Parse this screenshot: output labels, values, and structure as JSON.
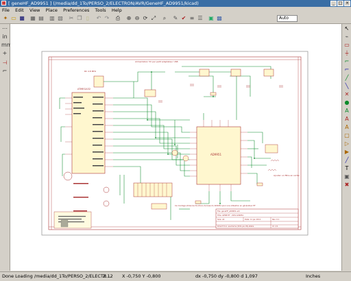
{
  "window": {
    "title": "[ geneHF_AD9951 ] (/media/dd_1To/PERSO_2/ELECTRON/AVR/GeneHF_AD9951/kicad)"
  },
  "menu": {
    "items": [
      "File",
      "Edit",
      "View",
      "Place",
      "Preferences",
      "Tools",
      "Help"
    ]
  },
  "toolbar": {
    "zoom": "Auto"
  },
  "schematic": {
    "title_top": "Alimentation 5V par petit adaptateur USB",
    "block_left_label": "RC 4.8 MHz",
    "note_right": "Ajouter un filtre en sortie",
    "note_bottom": "Ce montage utilise les fonctions de base du AD9951 pour une utilisation en générateur HF",
    "sheet_file": "File: geneHF_AD9951.sch",
    "sheet_title": "Title: GENE HF - DDS AD9951",
    "sheet_size": "Size: A4",
    "sheet_date": "Date: 11 jan 2011",
    "sheet_rev": "Rev: 0.1",
    "sheet_kicad": "KiCad E.D.A.  eeschema (2011-jan-09)-stable",
    "sheet_id": "Id: 1/1",
    "chip_label": "AD9951",
    "mcu_label": "ATMEGA32"
  },
  "statusbar": {
    "message": "Done Loading /media/dd_1To/PERSO_2/ELECTR...",
    "zoom": "Z 12",
    "coords": "X -0,750  Y -0,800",
    "delta": "dx -0,750  dy -0,800  d 1,097",
    "units": "Inches"
  }
}
